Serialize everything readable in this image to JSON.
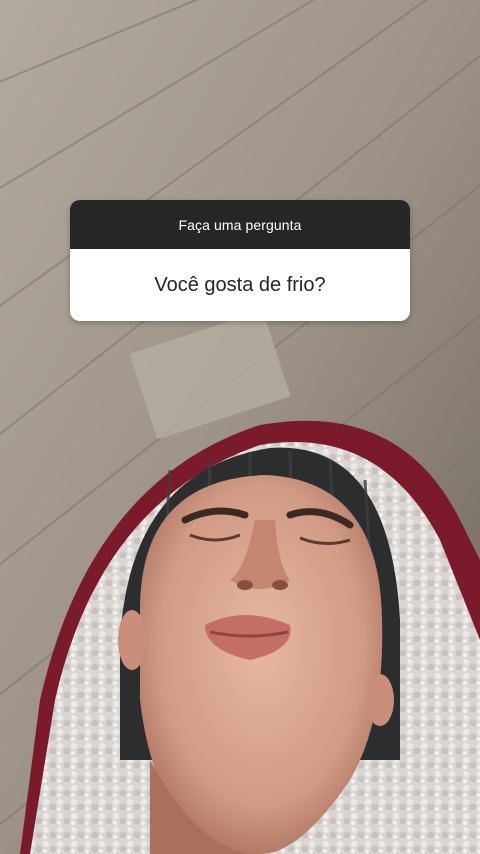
{
  "sticker": {
    "prompt": "Faça uma pergunta",
    "question": "Você gosta de frio?"
  },
  "colors": {
    "sticker_header_bg": "#262626",
    "sticker_body_bg": "#ffffff",
    "hoodie": "#7a1a2a",
    "sherpa_lining": "#d9d5d2"
  },
  "background": {
    "description_icon": "photo"
  }
}
